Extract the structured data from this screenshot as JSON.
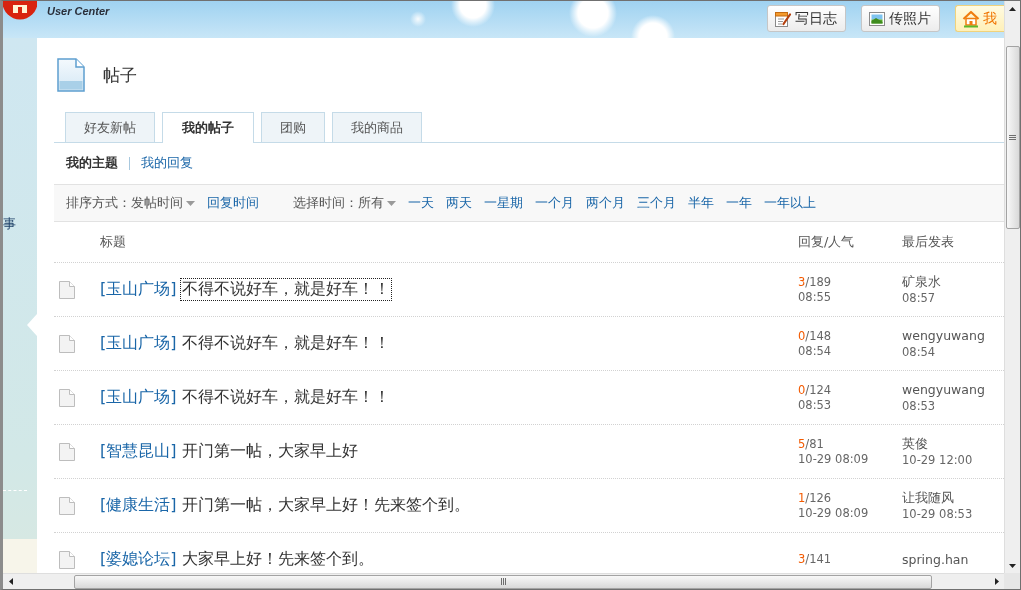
{
  "header": {
    "brand_subtitle": "User Center",
    "buttons": [
      {
        "kind": "diary",
        "label": "写日志"
      },
      {
        "kind": "photo",
        "label": "传照片"
      },
      {
        "kind": "home",
        "label": "我"
      }
    ]
  },
  "sidebar": {
    "text": "事"
  },
  "page": {
    "title": "帖子"
  },
  "tabs": [
    {
      "label": "好友新帖",
      "selected": false
    },
    {
      "label": "我的帖子",
      "selected": true
    },
    {
      "label": "团购",
      "selected": false
    },
    {
      "label": "我的商品",
      "selected": false
    }
  ],
  "subnav": [
    {
      "label": "我的主题",
      "selected": true
    },
    {
      "label": "我的回复",
      "selected": false
    }
  ],
  "filters": {
    "sort": {
      "label": "排序方式：",
      "options": [
        {
          "label": "发帖时间",
          "selected": true
        },
        {
          "label": "回复时间",
          "selected": false
        }
      ]
    },
    "time": {
      "label": "选择时间：",
      "options": [
        {
          "label": "所有",
          "selected": true
        },
        {
          "label": "一天",
          "selected": false
        },
        {
          "label": "两天",
          "selected": false
        },
        {
          "label": "一星期",
          "selected": false
        },
        {
          "label": "一个月",
          "selected": false
        },
        {
          "label": "两个月",
          "selected": false
        },
        {
          "label": "三个月",
          "selected": false
        },
        {
          "label": "半年",
          "selected": false
        },
        {
          "label": "一年",
          "selected": false
        },
        {
          "label": "一年以上",
          "selected": false
        }
      ]
    }
  },
  "table": {
    "columns": [
      "标题",
      "回复/人气",
      "最后发表"
    ],
    "rows": [
      {
        "category": "[玉山广场]",
        "title": "不得不说好车，就是好车！！",
        "focused": true,
        "replies": "3",
        "views": "/189",
        "post_time": "08:55",
        "last_poster": "矿泉水",
        "last_time": "08:57"
      },
      {
        "category": "[玉山广场]",
        "title": "不得不说好车，就是好车！！",
        "focused": false,
        "replies": "0",
        "views": "/148",
        "post_time": "08:54",
        "last_poster": "wengyuwang",
        "last_time": "08:54"
      },
      {
        "category": "[玉山广场]",
        "title": "不得不说好车，就是好车！！",
        "focused": false,
        "replies": "0",
        "views": "/124",
        "post_time": "08:53",
        "last_poster": "wengyuwang",
        "last_time": "08:53"
      },
      {
        "category": "[智慧昆山]",
        "title": "开门第一帖，大家早上好",
        "focused": false,
        "replies": "5",
        "views": "/81",
        "post_time": "10-29 08:09",
        "last_poster": "英俊",
        "last_time": "10-29 12:00"
      },
      {
        "category": "[健康生活]",
        "title": "开门第一帖，大家早上好！先来签个到。",
        "focused": false,
        "replies": "1",
        "views": "/126",
        "post_time": "10-29 08:09",
        "last_poster": "让我随风",
        "last_time": "10-29 08:53"
      },
      {
        "category": "[婆媳论坛]",
        "title": "大家早上好！先来签个到。",
        "focused": false,
        "replies": "3",
        "views": "/141",
        "last_poster": "spring.han"
      }
    ]
  }
}
